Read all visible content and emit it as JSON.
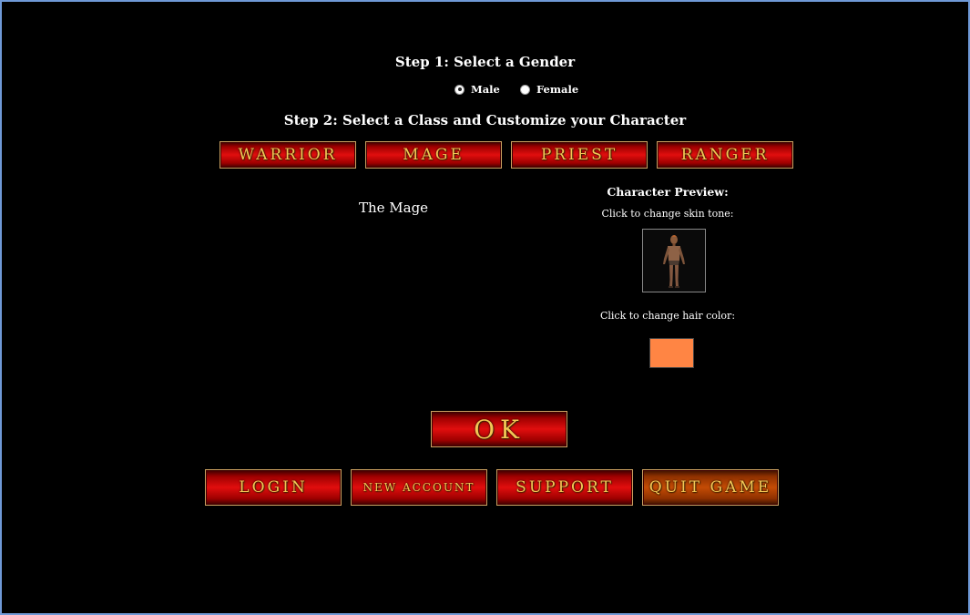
{
  "step1": {
    "title": "Step 1: Select a Gender",
    "options": [
      {
        "label": "Male",
        "selected": true
      },
      {
        "label": "Female",
        "selected": false
      }
    ]
  },
  "step2": {
    "title": "Step 2: Select a Class and Customize your Character",
    "classes": [
      "Warrior",
      "Mage",
      "Priest",
      "Ranger"
    ],
    "selected_class_title": "The Mage"
  },
  "preview": {
    "title": "Character Preview:",
    "skin_label": "Click to change skin tone:",
    "hair_label": "Click to change hair color:",
    "hair_color": "#ff8544"
  },
  "ok_label": "OK",
  "bottom_nav": [
    "Login",
    "New Account",
    "Support",
    "Quit Game"
  ],
  "colors": {
    "button_red": "#e10e0e",
    "button_text_gold": "#f3c755",
    "quit_button_orange": "#c44b05",
    "frame_border": "#6f99d6"
  }
}
